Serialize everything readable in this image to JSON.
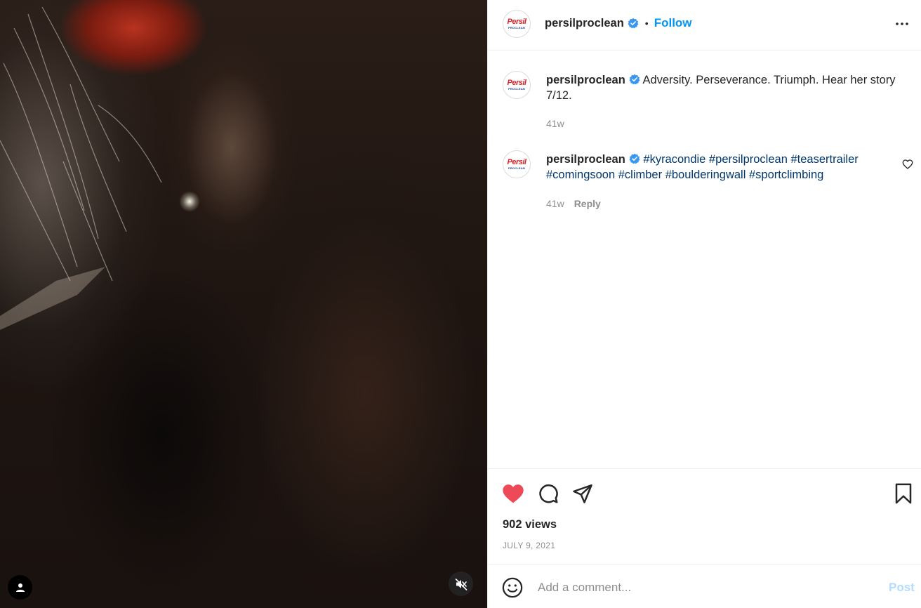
{
  "media": {
    "type": "video",
    "muted": true
  },
  "brand_logo": {
    "brand": "Persil",
    "sub": "PROCLEAN"
  },
  "header": {
    "username": "persilproclean",
    "verified": true,
    "separator": "•",
    "follow_label": "Follow",
    "more_icon": "more-horizontal-icon"
  },
  "caption": {
    "username": "persilproclean",
    "verified": true,
    "text": "Adversity. Perseverance. Triumph. Hear her story 7/12.",
    "age": "41w"
  },
  "comments": [
    {
      "username": "persilproclean",
      "verified": true,
      "hashtags": [
        "#kyracondie",
        "#persilproclean",
        "#teasertrailer",
        "#comingsoon",
        "#climber",
        "#boulderingwall",
        "#sportclimbing"
      ],
      "age": "41w",
      "reply_label": "Reply"
    }
  ],
  "actions": {
    "liked": true,
    "like_color": "#ed4956",
    "views": "902 views",
    "date": "JULY 9, 2021"
  },
  "add_comment": {
    "placeholder": "Add a comment...",
    "value": "",
    "post_label": "Post"
  },
  "colors": {
    "accent": "#0095f6",
    "hashtag": "#00376b",
    "verified": "#3897f0",
    "muted_text": "#8e8e8e",
    "post_disabled": "#b3dbff"
  }
}
